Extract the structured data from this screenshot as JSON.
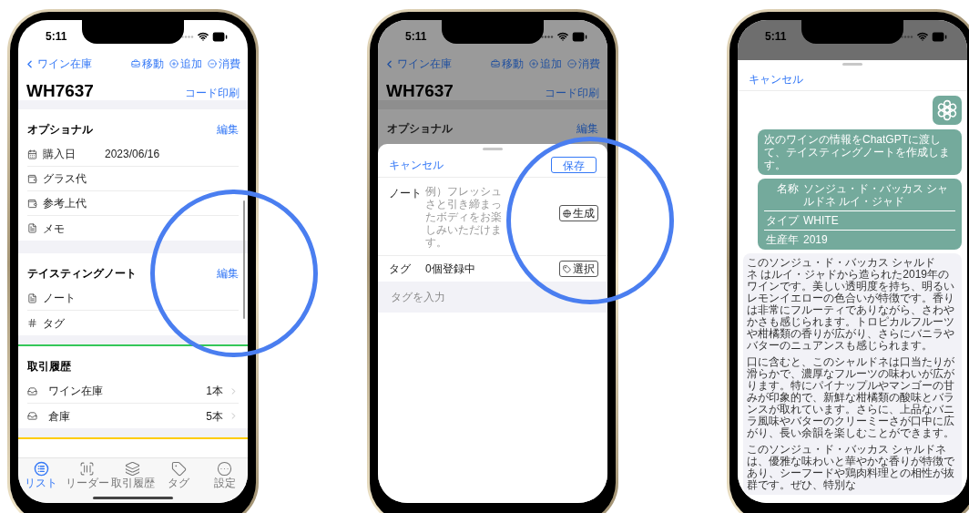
{
  "inventory_screen": {
    "status_time": "5:11",
    "nav": {
      "back": "ワイン在庫",
      "actions": [
        {
          "kind": "move",
          "label": "移動"
        },
        {
          "kind": "add",
          "label": "追加"
        },
        {
          "kind": "consume",
          "label": "消費"
        }
      ]
    },
    "title": "WH7637",
    "print_code": "コード印刷",
    "sections": [
      {
        "title": "オプショナル",
        "edit": "編集",
        "rows": [
          {
            "kind": "calendar",
            "label": "購入日",
            "value": "2023/06/16"
          },
          {
            "kind": "wallet",
            "label": "グラス代"
          },
          {
            "kind": "wallet",
            "label": "参考上代"
          },
          {
            "kind": "document",
            "label": "メモ"
          }
        ]
      },
      {
        "title": "テイスティングノート",
        "edit": "編集",
        "rows": [
          {
            "kind": "document",
            "label": "ノート"
          },
          {
            "kind": "hash",
            "label": "タグ"
          }
        ]
      },
      {
        "title": "取引履歴",
        "color": "#34c759",
        "rows": [
          {
            "kind": "tray",
            "label": "ワイン在庫",
            "value": "1本"
          },
          {
            "kind": "tray",
            "label": "倉庫",
            "value": "5本"
          }
        ]
      },
      {
        "color": "#ffcc00"
      }
    ],
    "tabs": [
      {
        "kind": "list",
        "label": "リスト",
        "selected": true
      },
      {
        "kind": "reader",
        "label": "リーダー",
        "selected": false
      },
      {
        "kind": "history",
        "label": "取引履歴",
        "selected": false
      },
      {
        "kind": "tag",
        "label": "タグ",
        "selected": false
      },
      {
        "kind": "more",
        "label": "設定",
        "selected": false
      }
    ]
  },
  "note_editor_screen": {
    "status_time": "5:11",
    "nav": {
      "back": "ワイン在庫",
      "actions": [
        {
          "kind": "move",
          "label": "移動"
        },
        {
          "kind": "add",
          "label": "追加"
        },
        {
          "kind": "consume",
          "label": "消費"
        }
      ]
    },
    "title": "WH7637",
    "print_code": "コード印刷",
    "section_title": "オプショナル",
    "section_edit": "編集",
    "sheet": {
      "cancel": "キャンセル",
      "save": "保存",
      "note": {
        "label": "ノート",
        "placeholder": "例）フレッシュさと引き締まったボディをお楽しみいただけます。",
        "generate": "生成"
      },
      "tags": {
        "label": "タグ",
        "count": "0個登録中",
        "select": "選択"
      },
      "tag_input": {
        "placeholder": "タグを入力"
      }
    }
  },
  "chatgpt_screen": {
    "status_time": "5:11",
    "cancel": "キャンセル",
    "intro": "次のワインの情報をChatGPTに渡して、テイスティングノートを作成します。",
    "wine_info": [
      {
        "label": "名称",
        "value": "ソンジュ・ド・バッカス シャルドネ ルイ・ジャド"
      },
      {
        "label": "タイプ",
        "value": "WHITE"
      },
      {
        "label": "生産年",
        "value": "2019"
      }
    ],
    "response": [
      "このソンジュ・ド・バッカス シャルドネ はルイ・ジャドから造られた2019年のワインです。美しい透明度を持ち、明るいレモンイエローの色合いが特徴です。香りは非常にフルーティでありながら、さわやかさも感じられます。トロピカルフルーツや柑橘類の香りが広がり、さらにバニラやバターのニュアンスも感じられます。",
      "口に含むと、このシャルドネは口当たりが滑らかで、濃厚なフルーツの味わいが広がります。特にパイナップルやマンゴーの甘みが印象的で、新鮮な柑橘類の酸味とバランスが取れています。さらに、上品なバニラ風味やバターのクリーミーさが口中に広がり、長い余韻を楽しむことができます。",
      "このソンジュ・ド・バッカス シャルドネは、優雅な味わいと華やかな香りが特徴であり、シーフードや鶏肉料理との相性が抜群です。ぜひ、特別な"
    ]
  }
}
